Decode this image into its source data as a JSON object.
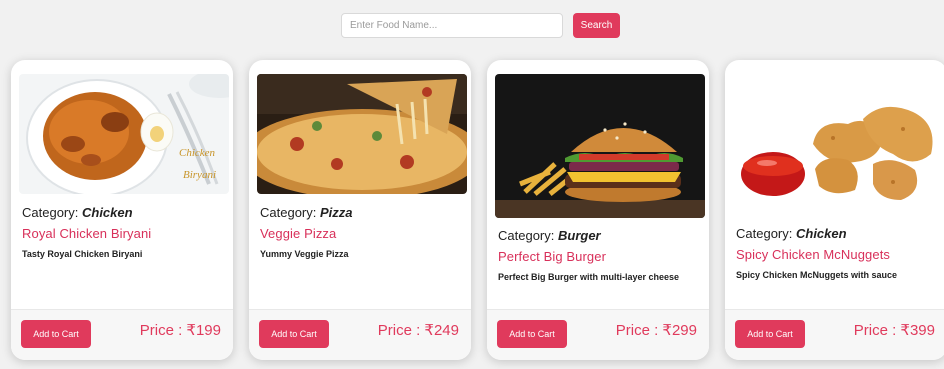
{
  "search": {
    "placeholder": "Enter Food Name...",
    "button_label": "Search"
  },
  "category_prefix": "Category: ",
  "add_to_cart_label": "Add to Cart",
  "price_prefix": "Price : ",
  "cards": [
    {
      "category": "Chicken",
      "name": "Royal Chicken Biryani",
      "description": "Tasty Royal Chicken Biryani",
      "price": "₹199",
      "image_text": "Chicken\nBiryani"
    },
    {
      "category": "Pizza",
      "name": "Veggie Pizza",
      "description": "Yummy Veggie Pizza",
      "price": "₹249"
    },
    {
      "category": "Burger",
      "name": "Perfect Big Burger",
      "description": "Perfect Big Burger with multi-layer cheese",
      "price": "₹299"
    },
    {
      "category": "Chicken",
      "name": "Spicy Chicken McNuggets",
      "description": "Spicy Chicken McNuggets with sauce",
      "price": "₹399"
    }
  ],
  "colors": {
    "accent": "#e03a5c",
    "page_bg": "#f1f1f1",
    "card_bg": "#ffffff"
  }
}
